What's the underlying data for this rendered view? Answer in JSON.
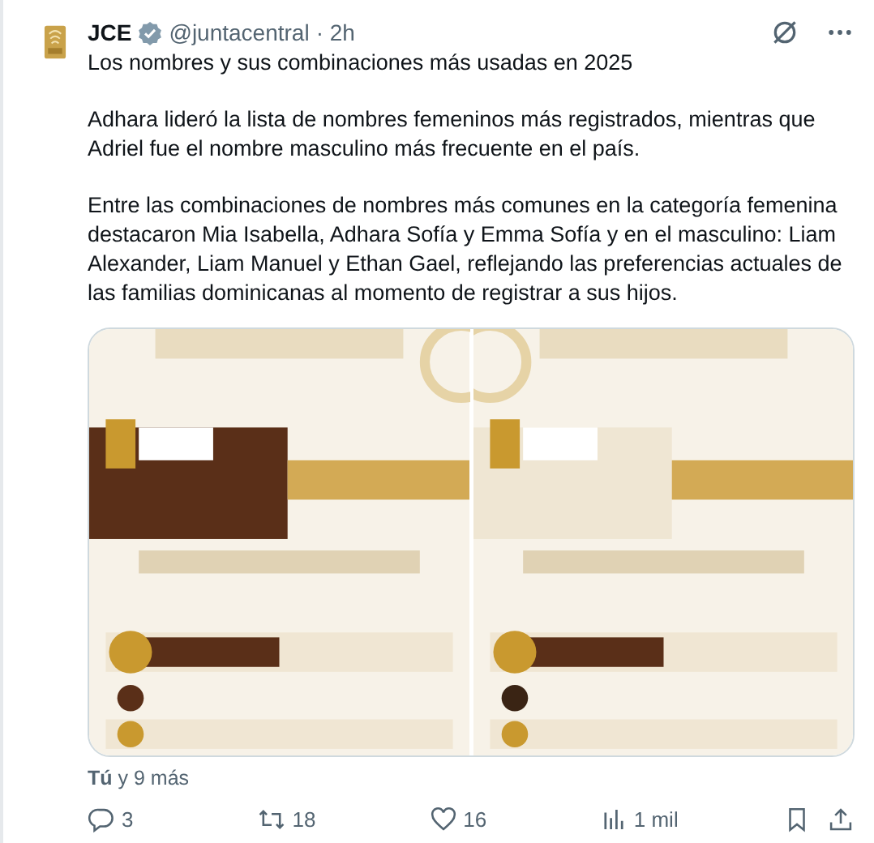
{
  "post": {
    "author": "JCE",
    "verified": true,
    "handle": "@juntacentral",
    "time": "· 2h",
    "paragraphs": [
      "Los nombres y sus combinaciones más usadas en 2025",
      "Adhara lideró la lista de nombres femeninos más registrados, mientras que Adriel fue el nombre masculino más frecuente en el país.",
      "Entre las combinaciones de nombres más comunes en la categoría femenina destacaron Mia Isabella, Adhara Sofía y Emma Sofía y en el masculino: Liam Alexander, Liam Manuel y Ethan Gael, reflejando las preferencias actuales de las familias dominicanas al momento de registrar a sus hijos."
    ],
    "liked_by": {
      "bold": "Tú",
      "rest": "y 9 más"
    },
    "actions": [
      {
        "kind": "reply",
        "count": "3"
      },
      {
        "kind": "repost",
        "count": "18"
      },
      {
        "kind": "like",
        "count": "16"
      },
      {
        "kind": "views",
        "count": "1 mil"
      },
      {
        "kind": "bookmark"
      },
      {
        "kind": "share"
      }
    ]
  }
}
